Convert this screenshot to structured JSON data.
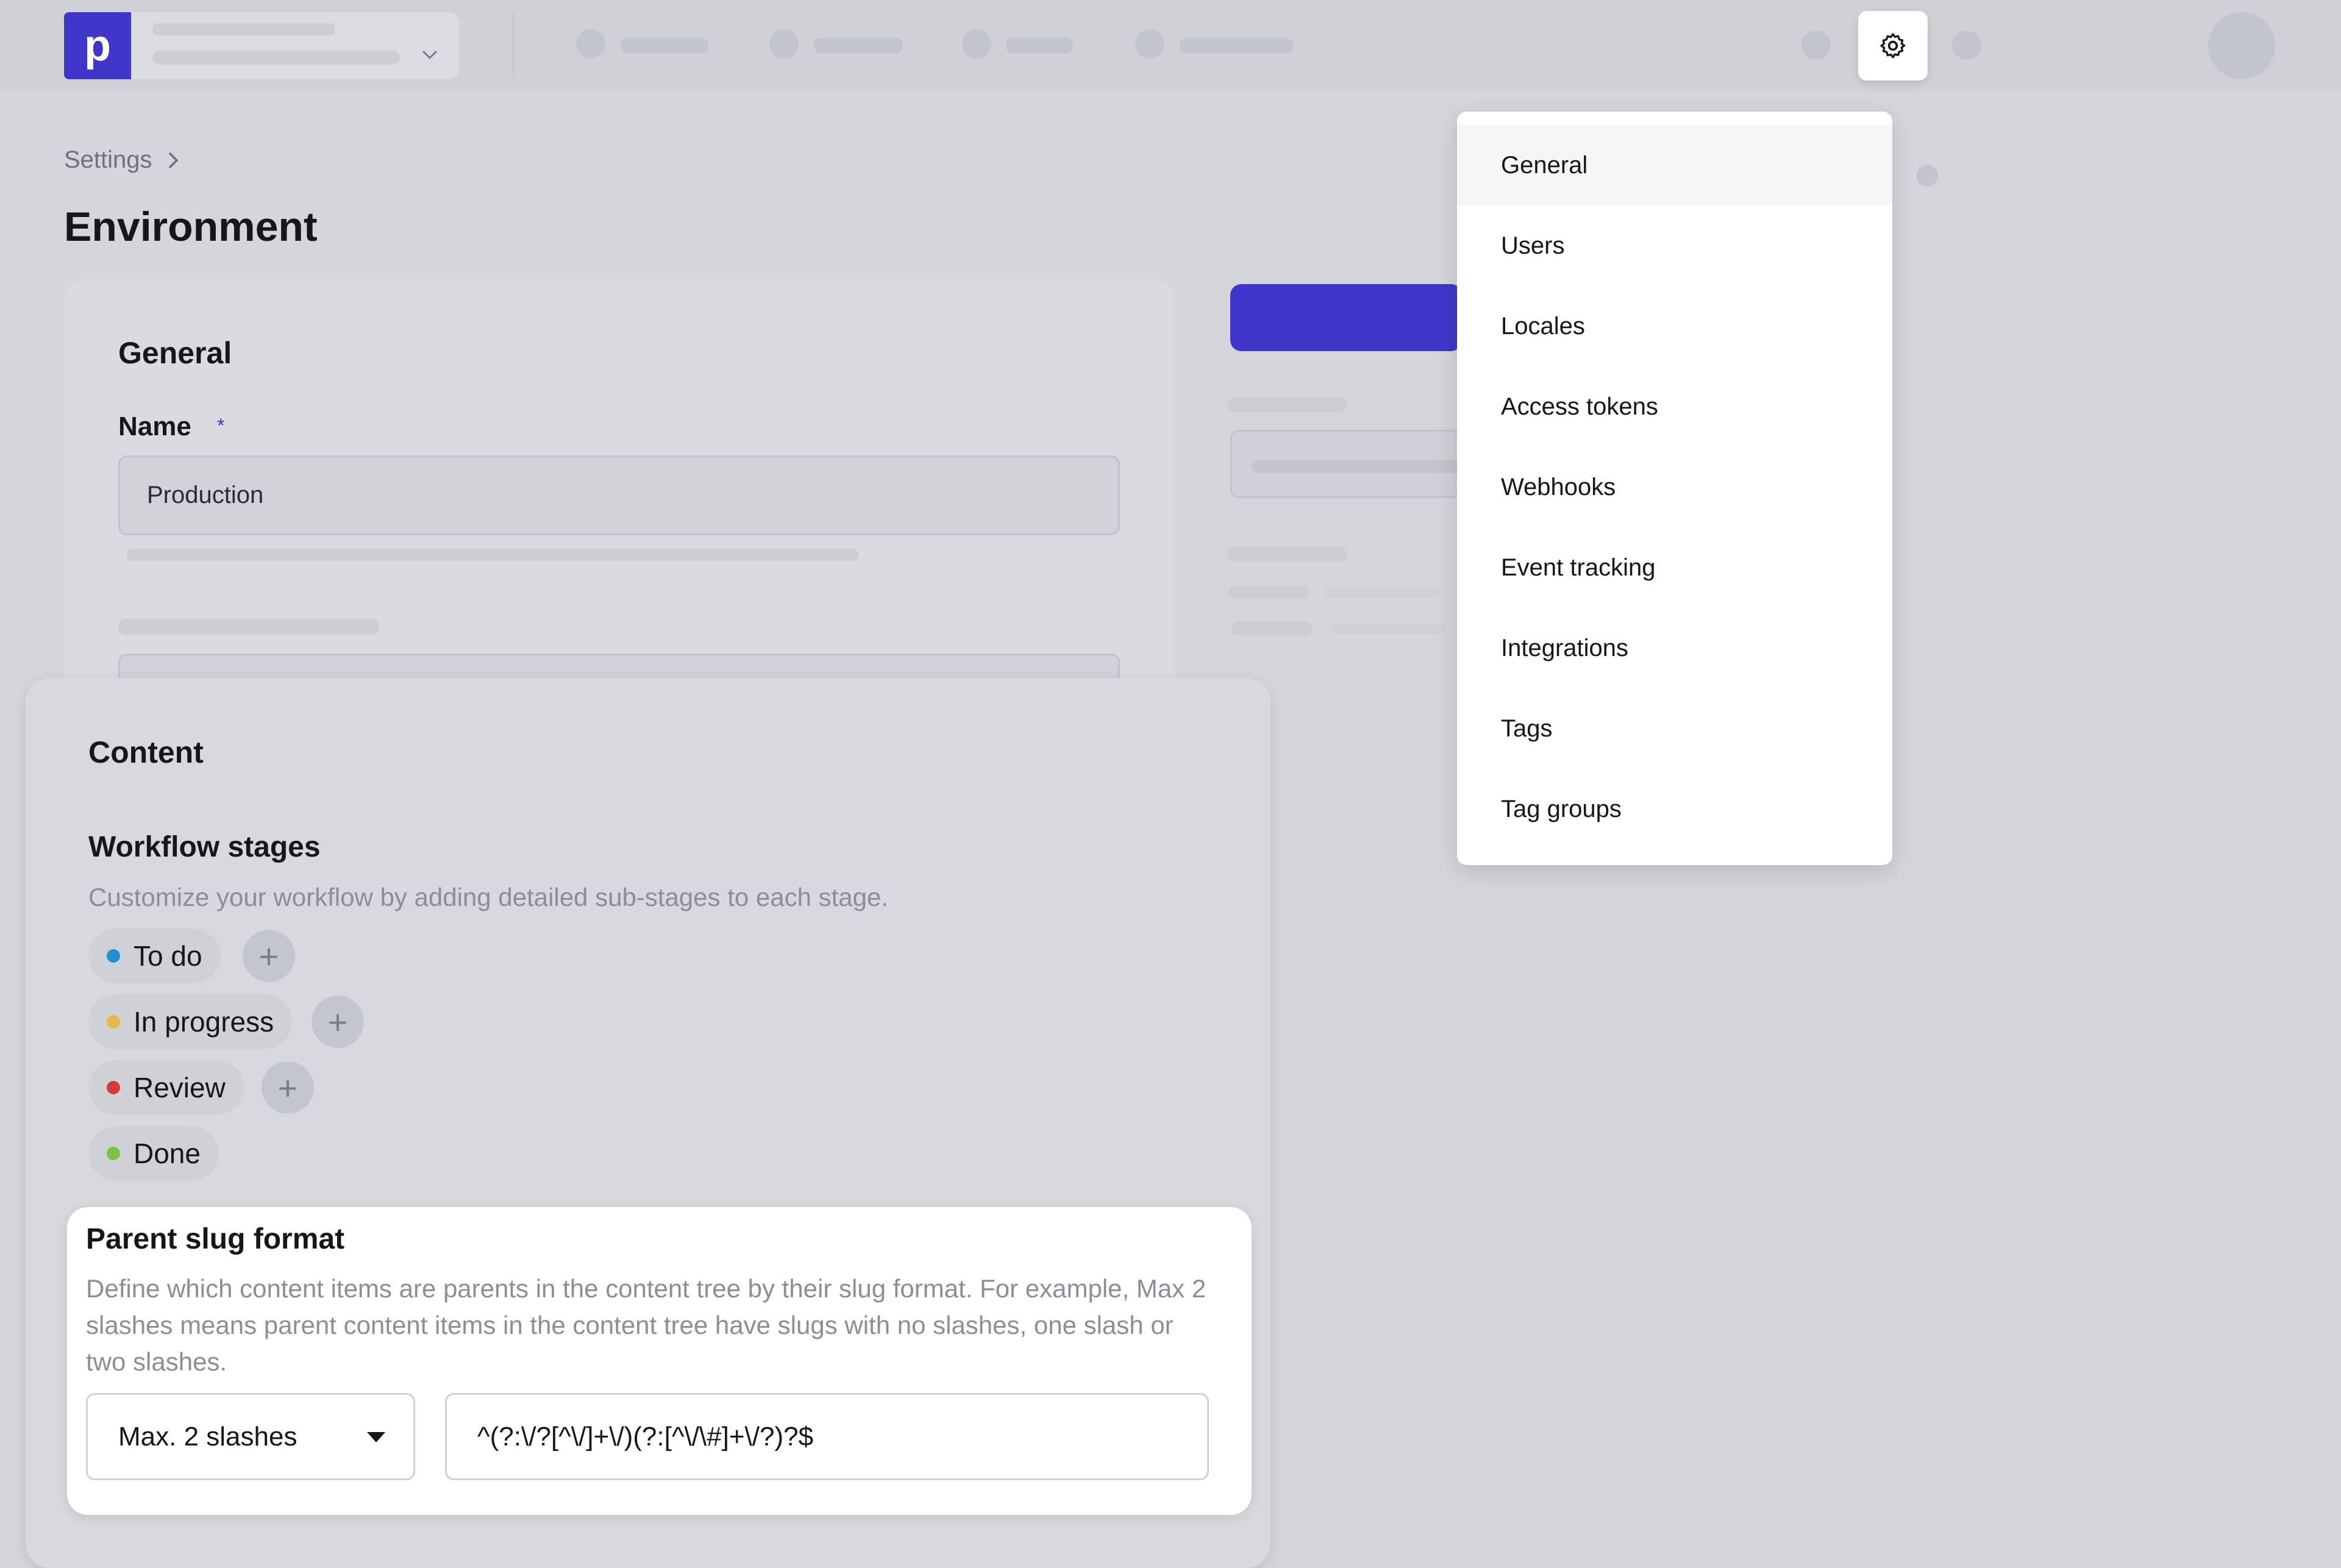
{
  "logo": {
    "letter": "p"
  },
  "breadcrumb": {
    "root": "Settings"
  },
  "page": {
    "title": "Environment"
  },
  "general_card": {
    "title": "General",
    "name_label": "Name",
    "required_mark": "*",
    "name_value": "Production"
  },
  "content_card": {
    "title": "Content",
    "workflow": {
      "title": "Workflow stages",
      "description": "Customize your workflow by adding detailed sub-stages to each stage.",
      "stages": [
        {
          "label": "To do",
          "color": "#1f8fd6",
          "has_add": true
        },
        {
          "label": "In progress",
          "color": "#e5b84b",
          "has_add": true
        },
        {
          "label": "Review",
          "color": "#d9363e",
          "has_add": true
        },
        {
          "label": "Done",
          "color": "#7dc243",
          "has_add": false
        }
      ],
      "add_symbol": "+"
    },
    "slug": {
      "title": "Parent slug format",
      "description": "Define which content items are parents in the content tree by their slug format. For example, Max 2 slashes means parent content items in the content tree have slugs with no slashes, one slash or two slashes.",
      "select_value": "Max. 2 slashes",
      "regex_value": "^(?:\\/?[^\\/]+\\/)(?:[^\\/\\#]+\\/?)?$"
    }
  },
  "settings_menu": {
    "items": [
      "General",
      "Users",
      "Locales",
      "Access tokens",
      "Webhooks",
      "Event tracking",
      "Integrations",
      "Tags",
      "Tag groups"
    ],
    "active": "General"
  },
  "icons": {
    "settings": "gear-icon",
    "breadcrumb_sep": "chevron-right-icon",
    "project_dropdown": "chevron-down-icon",
    "select_caret": "caret-down-icon"
  },
  "colors": {
    "brand": "#3f37c9",
    "dim_background": "#d4d6dc"
  }
}
